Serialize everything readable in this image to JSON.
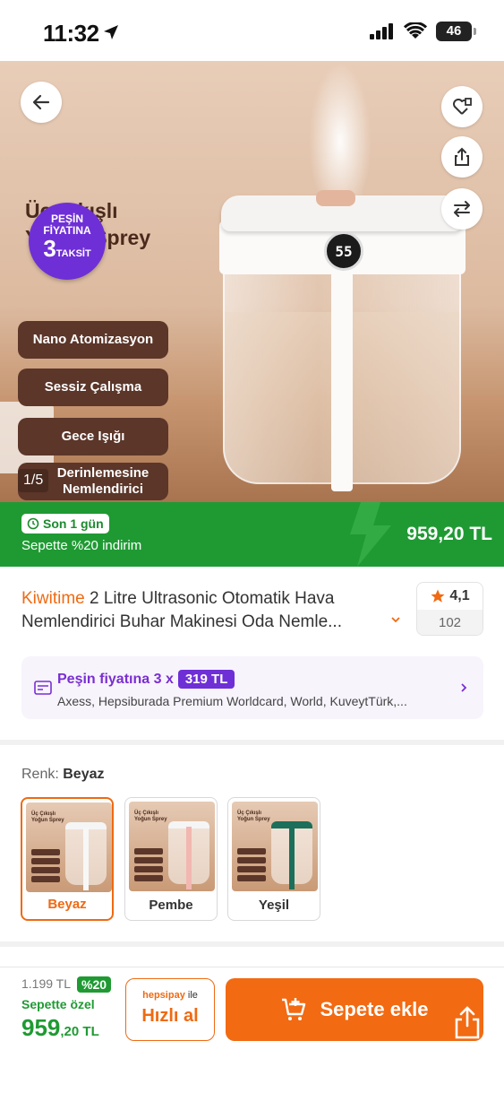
{
  "status_bar": {
    "time": "11:32",
    "battery": "46"
  },
  "hero": {
    "title_line1": "Üç Çıkışlı",
    "title_line2": "Yoğun Sprey",
    "badge": {
      "line1": "PEŞİN",
      "line2": "FİYATINA",
      "line3_num": "3",
      "line3_text": "TAKSİT"
    },
    "features": [
      "Nano Atomizasyon",
      "Sessiz Çalışma",
      "Gece Işığı",
      "Derinlemesine Nemlendirici"
    ],
    "display_value": "55",
    "image_counter": "1/5"
  },
  "banner": {
    "tag": "Son 1 gün",
    "text": "Sepette %20 indirim",
    "price": "959,20 TL"
  },
  "product": {
    "brand": "Kiwitime",
    "title": " 2 Litre Ultrasonic Otomatik Hava Nemlendirici Buhar Makinesi Oda Nemle...",
    "rating": "4,1",
    "review_count": "102"
  },
  "installment": {
    "prefix": "Peşin fiyatına 3 x",
    "amount": "319 TL",
    "cards": "Axess, Hepsiburada Premium Worldcard, World, KuveytTürk,..."
  },
  "color_selector": {
    "label": "Renk:",
    "selected": "Beyaz",
    "options": [
      {
        "name": "Beyaz",
        "tube_color": "#f7f7f7",
        "cap_color": "#f5f5f5"
      },
      {
        "name": "Pembe",
        "tube_color": "#f2b7b0",
        "cap_color": "#f5f5f5"
      },
      {
        "name": "Yeşil",
        "tube_color": "#1c6f5a",
        "cap_color": "#1c6f5a"
      }
    ],
    "thumb_title": "Üç Çıkışlı Yoğun Sprey"
  },
  "bottom": {
    "old_price": "1.199 TL",
    "discount": "%20",
    "special_label": "Sepette özel",
    "final_price_main": "959",
    "final_price_rest": ",20 TL",
    "hepsipay": "hepsipay",
    "hepsipay_suffix": " ile",
    "quick_buy": "Hızlı al",
    "add_to_cart": "Sepete ekle"
  },
  "colors": {
    "accent": "#ef6a12",
    "green": "#1f9a33",
    "purple": "#6f2fd6",
    "brown": "#5b3629"
  }
}
